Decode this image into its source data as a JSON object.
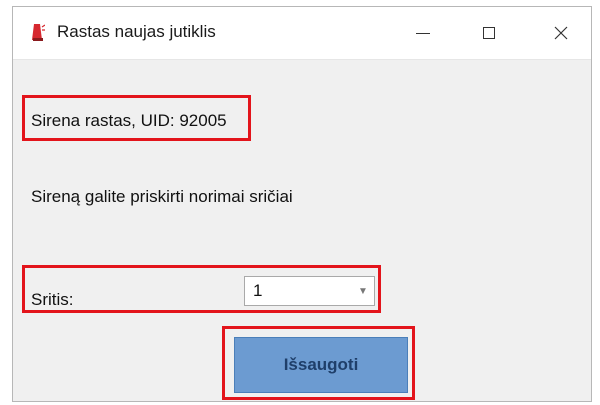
{
  "window": {
    "title": "Rastas naujas jutiklis",
    "icon": "siren-app-icon"
  },
  "content": {
    "found_text": "Sirena rastas, UID: 92005",
    "assign_text": "Sireną galite priskirti norimai sričiai",
    "area_label": "Sritis:",
    "area_selected": "1",
    "save_label": "Išsaugoti"
  },
  "colors": {
    "highlight": "#e3141b",
    "button": "#6c9bd1",
    "background": "#f0f0f0"
  }
}
